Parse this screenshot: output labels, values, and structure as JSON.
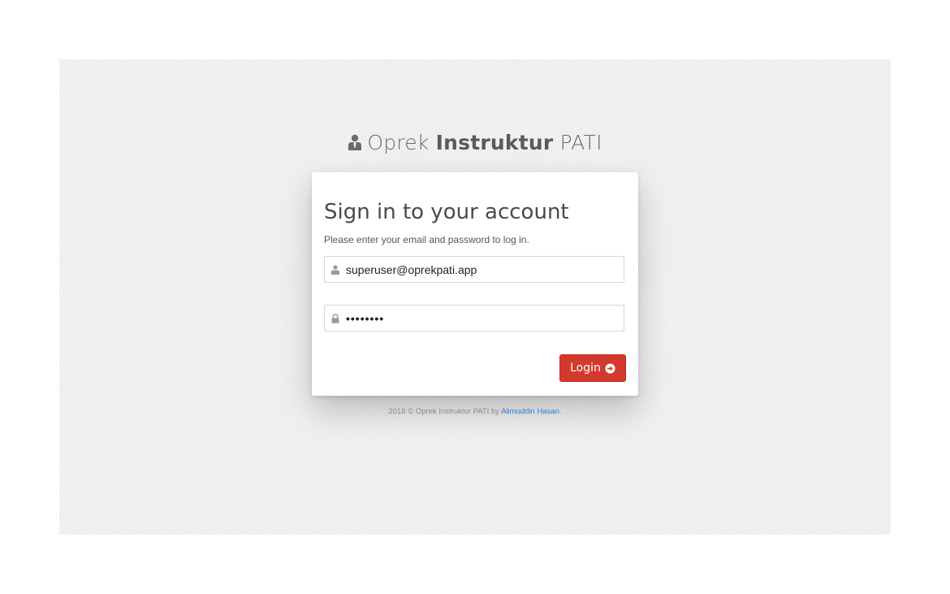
{
  "brand": {
    "prefix": "Oprek",
    "bold": "Instruktur",
    "suffix": "PATI",
    "icon": "user-tie-icon"
  },
  "login_card": {
    "title": "Sign in to your account",
    "subtitle": "Please enter your email and password to log in.",
    "email": {
      "value": "superuser@oprekpati.app",
      "icon": "user-icon"
    },
    "password": {
      "value": "••••••••",
      "icon": "lock-icon"
    },
    "login_button": {
      "label": "Login",
      "icon": "arrow-circle-right-icon",
      "color": "#d33a2c"
    }
  },
  "footer": {
    "text": "2018 © Oprek Instruktur PATI by ",
    "author_link": "Alimuddin Hasan",
    "end": ".",
    "link_color": "#2a7fd4"
  }
}
